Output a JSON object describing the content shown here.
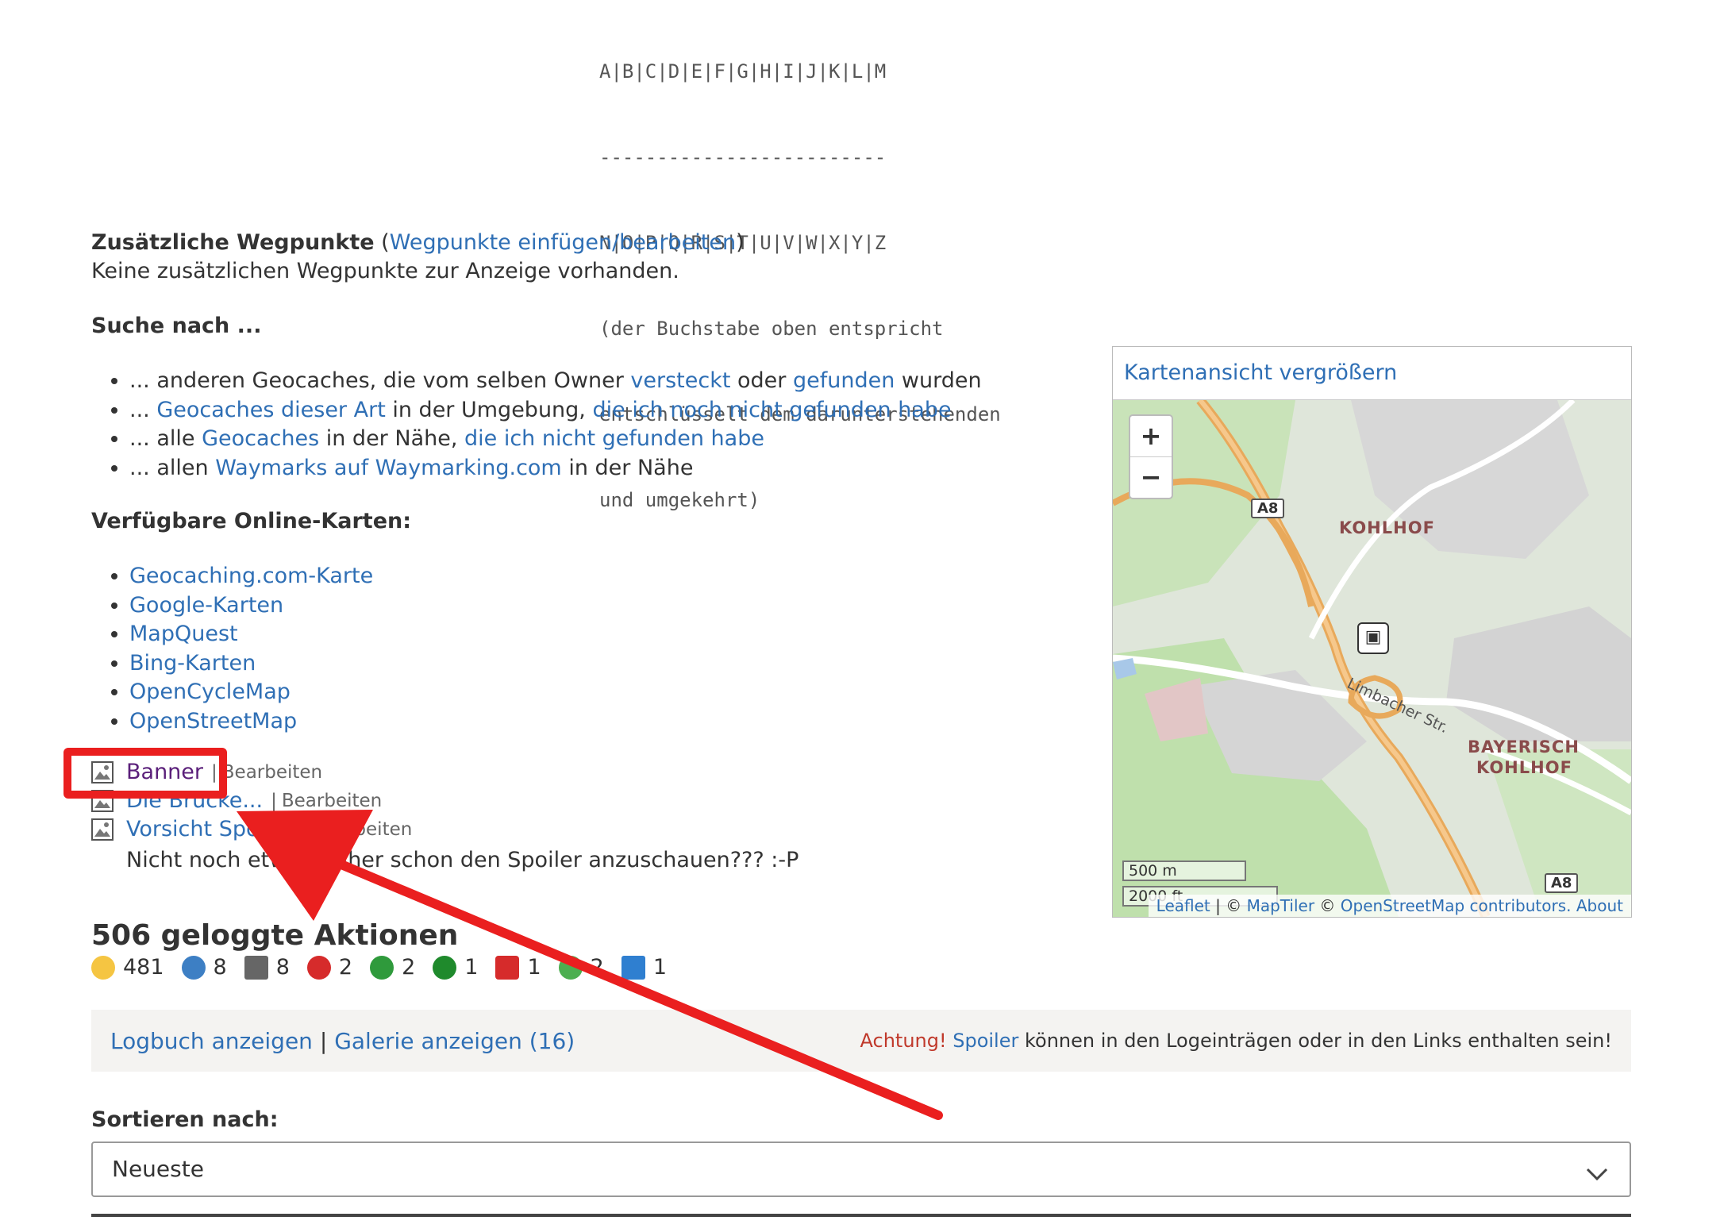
{
  "cipher": {
    "lines": [
      "A|B|C|D|E|F|G|H|I|J|K|L|M",
      "-------------------------",
      "N|O|P|Q|R|S|T|U|V|W|X|Y|Z",
      "(der Buchstabe oben entspricht",
      "entschlüsselt dem darunterstehenden",
      "und umgekehrt)"
    ]
  },
  "waypoints": {
    "heading": "Zusätzliche Wegpunkte",
    "edit_link": "Wegpunkte einfügen/bearbeiten",
    "none_text": "Keine zusätzlichen Wegpunkte zur Anzeige vorhanden."
  },
  "search": {
    "heading": "Suche nach ...",
    "items": [
      {
        "t1": "... anderen Geocaches, die vom selben Owner ",
        "l1": "versteckt",
        "t2": " oder ",
        "l2": "gefunden",
        "t3": " wurden"
      },
      {
        "t1": "... ",
        "l1": "Geocaches dieser Art",
        "t2": " in der Umgebung, ",
        "l2": "die ich noch nicht gefunden habe",
        "t3": ""
      },
      {
        "t1": "... alle ",
        "l1": "Geocaches",
        "t2": " in der Nähe, ",
        "l2": "die ich nicht gefunden habe",
        "t3": ""
      },
      {
        "t1": "... allen ",
        "l1": "Waymarks auf Waymarking.com",
        "t2": " in der Nähe",
        "l2": "",
        "t3": ""
      }
    ]
  },
  "online_maps": {
    "heading": "Verfügbare Online-Karten:",
    "items": [
      "Geocaching.com-Karte",
      "Google-Karten",
      "MapQuest",
      "Bing-Karten",
      "OpenCycleMap",
      "OpenStreetMap"
    ]
  },
  "pictures": {
    "separator": "|",
    "edit_label": "Bearbeiten",
    "items": [
      {
        "title": "Banner"
      },
      {
        "title": "Die Brücke..."
      },
      {
        "title": "Vorsicht Spoiler"
      }
    ],
    "spoiler_note": "Nicht noch etwas früher schon den Spoiler anzuschauen??? :-P"
  },
  "map": {
    "header_link": "Kartenansicht vergrößern",
    "zoom_in": "+",
    "zoom_out": "−",
    "labels": [
      "KOHLHOF",
      "BAYERISCH",
      "KOHLHOF"
    ],
    "road_shield": "A8",
    "street_name": "Limbacher Str.",
    "scale_m": "500 m",
    "scale_ft": "2000 ft",
    "attribution": {
      "leaflet": "Leaflet",
      "sep1": " | © ",
      "maptiler": "MapTiler",
      "sep2": " © ",
      "osm": "OpenStreetMap contributors.",
      "about": "About"
    }
  },
  "logs": {
    "title": "506 geloggte Aktionen",
    "counts": [
      {
        "icon": "smiley-found-icon",
        "value": "481"
      },
      {
        "icon": "sad-not-found-icon",
        "value": "8"
      },
      {
        "icon": "note-icon",
        "value": "8"
      },
      {
        "icon": "disabled-icon",
        "value": "2"
      },
      {
        "icon": "check-enabled-icon",
        "value": "2"
      },
      {
        "icon": "publish-icon",
        "value": "1"
      },
      {
        "icon": "wrench-maintenance-icon",
        "value": "1"
      },
      {
        "icon": "green-icon",
        "value": "2"
      },
      {
        "icon": "reviewer-icon",
        "value": "1"
      }
    ]
  },
  "logbar": {
    "logbook_link": "Logbuch anzeigen",
    "sep": "|",
    "gallery_link": "Galerie anzeigen (16)",
    "warn_word": "Achtung!",
    "spoiler_link": "Spoiler",
    "warn_rest": " können in den Logeinträgen oder in den Links enthalten sein!"
  },
  "sort": {
    "label": "Sortieren nach:",
    "selected": "Neueste"
  },
  "colors": {
    "link": "#2f6fb5",
    "annotation_red": "#ea1f1f",
    "warning": "#c0392b"
  }
}
